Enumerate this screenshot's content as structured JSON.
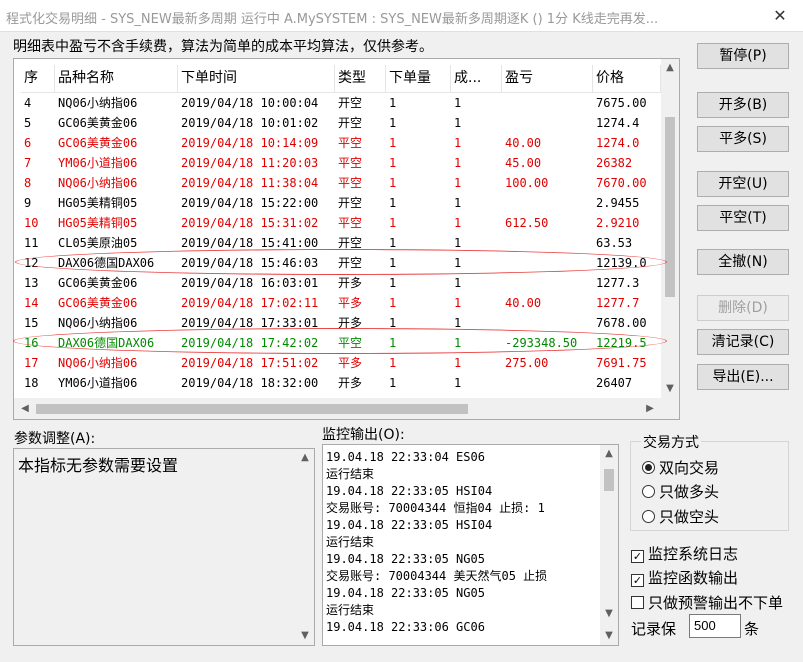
{
  "window": {
    "title": "程式化交易明细 - SYS_NEW最新多周期 运行中  A.MySYSTEM : SYS_NEW最新多周期逐K () 1分 K线走完再发...",
    "close_glyph": "✕"
  },
  "note": "明细表中盈亏不含手续费，算法为简单的成本平均算法，仅供参考。",
  "table": {
    "columns": [
      "序",
      "品种名称",
      "下单时间",
      "类型",
      "下单量",
      "成...",
      "盈亏",
      "价格"
    ],
    "rows": [
      {
        "seq": "4",
        "name": "NQ06小纳指06",
        "time": "2019/04/18 10:00:04",
        "type": "开空",
        "qty": "1",
        "filled": "1",
        "pnl": "",
        "price": "7675.00",
        "color": "black"
      },
      {
        "seq": "5",
        "name": "GC06美黄金06",
        "time": "2019/04/18 10:01:02",
        "type": "开空",
        "qty": "1",
        "filled": "1",
        "pnl": "",
        "price": "1274.4",
        "color": "black"
      },
      {
        "seq": "6",
        "name": "GC06美黄金06",
        "time": "2019/04/18 10:14:09",
        "type": "平空",
        "qty": "1",
        "filled": "1",
        "pnl": "40.00",
        "price": "1274.0",
        "color": "red"
      },
      {
        "seq": "7",
        "name": "YM06小道指06",
        "time": "2019/04/18 11:20:03",
        "type": "平空",
        "qty": "1",
        "filled": "1",
        "pnl": "45.00",
        "price": "26382",
        "color": "red"
      },
      {
        "seq": "8",
        "name": "NQ06小纳指06",
        "time": "2019/04/18 11:38:04",
        "type": "平空",
        "qty": "1",
        "filled": "1",
        "pnl": "100.00",
        "price": "7670.00",
        "color": "red"
      },
      {
        "seq": "9",
        "name": "HG05美精铜05",
        "time": "2019/04/18 15:22:00",
        "type": "开空",
        "qty": "1",
        "filled": "1",
        "pnl": "",
        "price": "2.9455",
        "color": "black"
      },
      {
        "seq": "10",
        "name": "HG05美精铜05",
        "time": "2019/04/18 15:31:02",
        "type": "平空",
        "qty": "1",
        "filled": "1",
        "pnl": "612.50",
        "price": "2.9210",
        "color": "red"
      },
      {
        "seq": "11",
        "name": "CL05美原油05",
        "time": "2019/04/18 15:41:00",
        "type": "开空",
        "qty": "1",
        "filled": "1",
        "pnl": "",
        "price": "63.53",
        "color": "black"
      },
      {
        "seq": "12",
        "name": "DAX06德国DAX06",
        "time": "2019/04/18 15:46:03",
        "type": "开空",
        "qty": "1",
        "filled": "1",
        "pnl": "",
        "price": "12139.0",
        "color": "black"
      },
      {
        "seq": "13",
        "name": "GC06美黄金06",
        "time": "2019/04/18 16:03:01",
        "type": "开多",
        "qty": "1",
        "filled": "1",
        "pnl": "",
        "price": "1277.3",
        "color": "black"
      },
      {
        "seq": "14",
        "name": "GC06美黄金06",
        "time": "2019/04/18 17:02:11",
        "type": "平多",
        "qty": "1",
        "filled": "1",
        "pnl": "40.00",
        "price": "1277.7",
        "color": "red"
      },
      {
        "seq": "15",
        "name": "NQ06小纳指06",
        "time": "2019/04/18 17:33:01",
        "type": "开多",
        "qty": "1",
        "filled": "1",
        "pnl": "",
        "price": "7678.00",
        "color": "black"
      },
      {
        "seq": "16",
        "name": "DAX06德国DAX06",
        "time": "2019/04/18 17:42:02",
        "type": "平空",
        "qty": "1",
        "filled": "1",
        "pnl": "-293348.50",
        "price": "12219.5",
        "color": "green"
      },
      {
        "seq": "17",
        "name": "NQ06小纳指06",
        "time": "2019/04/18 17:51:02",
        "type": "平多",
        "qty": "1",
        "filled": "1",
        "pnl": "275.00",
        "price": "7691.75",
        "color": "red"
      },
      {
        "seq": "18",
        "name": "YM06小道指06",
        "time": "2019/04/18 18:32:00",
        "type": "开多",
        "qty": "1",
        "filled": "1",
        "pnl": "",
        "price": "26407",
        "color": "black"
      }
    ]
  },
  "buttons": {
    "pause": "暂停(P)",
    "open_long": "开多(B)",
    "close_long": "平多(S)",
    "open_short": "开空(U)",
    "close_short": "平空(T)",
    "cancel_all": "全撤(N)",
    "delete": "删除(D)",
    "clear_log": "清记录(C)",
    "export": "导出(E)..."
  },
  "params": {
    "label": "参数调整(A):",
    "text": "本指标无参数需要设置"
  },
  "monitor": {
    "label": "监控输出(O):",
    "lines": [
      "19.04.18 22:33:04 ES06",
      "运行结束",
      "19.04.18 22:33:05 HSI04",
      "  交易账号:  70004344 恒指04 止损: 1",
      "19.04.18 22:33:05 HSI04",
      "运行结束",
      "19.04.18 22:33:05 NG05",
      "  交易账号:  70004344 美天然气05 止损",
      "19.04.18 22:33:05 NG05",
      "运行结束",
      "19.04.18 22:33:06 GC06"
    ]
  },
  "trade_mode": {
    "label": "交易方式",
    "options": [
      "双向交易",
      "只做多头",
      "只做空头"
    ],
    "selected": "双向交易"
  },
  "checks": {
    "sys_log": {
      "label": "监控系统日志",
      "checked": true
    },
    "func_output": {
      "label": "监控函数输出",
      "checked": true
    },
    "warn_only": {
      "label": "只做预警输出不下单",
      "checked": false
    }
  },
  "keep": {
    "label": "记录保",
    "value": "500",
    "unit": "条"
  }
}
